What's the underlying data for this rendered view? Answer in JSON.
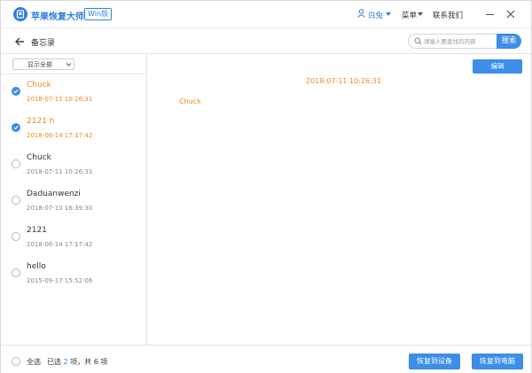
{
  "app": {
    "name": "苹果恢复大师",
    "edition_badge": "Win版"
  },
  "titlebar": {
    "user_name": "白兔",
    "menu_label": "菜单",
    "contact_label": "联系我们"
  },
  "header": {
    "page_title": "备忘录",
    "search_placeholder": "请输入要查找的内容",
    "search_button": "搜索"
  },
  "filter": {
    "selected": "显示全部"
  },
  "notes": [
    {
      "title": "Chuck",
      "date": "2018-07-11 10:26:31",
      "checked": true
    },
    {
      "title": "2121 h",
      "date": "2018-06-14 17:17:42",
      "checked": true
    },
    {
      "title": "Chuck",
      "date": "2018-07-11 10:26:31",
      "checked": false
    },
    {
      "title": "Daduanwenzi",
      "date": "2018-07-10 16:39:30",
      "checked": false
    },
    {
      "title": "2121",
      "date": "2018-06-14 17:17:42",
      "checked": false
    },
    {
      "title": "hello",
      "date": "2015-09-17 15:52:06",
      "checked": false
    }
  ],
  "detail": {
    "edit_button": "编辑",
    "date": "2018-07-11 10:26:31",
    "body": "Chuck"
  },
  "footer": {
    "select_all": "全选",
    "selected_prefix": "已选",
    "selected_count": "2",
    "selected_mid": "项，共",
    "total_count": "6",
    "selected_suffix": "项",
    "restore_device": "恢复到设备",
    "restore_pc": "恢复到电脑"
  },
  "colors": {
    "accent": "#3c8ee8",
    "highlight": "#f08a24"
  }
}
